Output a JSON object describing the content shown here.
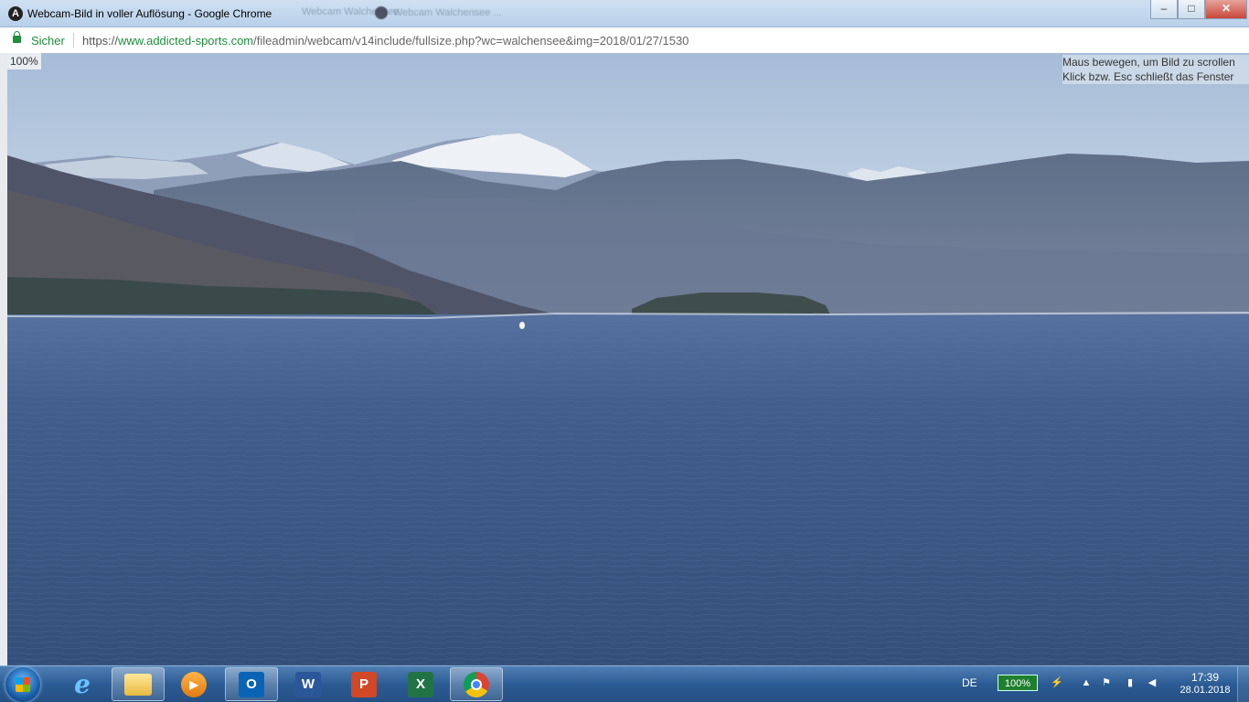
{
  "window": {
    "icon_letter": "A",
    "title": "Webcam-Bild in voller Auflösung - Google Chrome",
    "background_tabs": [
      "Webcam Walchensee",
      "Webcam Walchensee ..."
    ],
    "buttons": {
      "minimize": "–",
      "maximize": "□",
      "close": "✕"
    }
  },
  "address_bar": {
    "security_label": "Sicher",
    "url_scheme": "https://",
    "url_host": "www.addicted-sports.com",
    "url_path": "/fileadmin/webcam/v14include/fullsize.php?wc=walchensee&img=2018/01/27/1530"
  },
  "viewer": {
    "zoom_label": "100%",
    "hint_line1": "Maus bewegen, um Bild zu scrollen",
    "hint_line2": "Klick bzw. Esc schließt das Fenster"
  },
  "taskbar": {
    "apps": [
      {
        "name": "internet-explorer",
        "glyph": "e"
      },
      {
        "name": "file-explorer",
        "glyph": ""
      },
      {
        "name": "media-player",
        "glyph": "▶"
      },
      {
        "name": "outlook",
        "glyph": "O"
      },
      {
        "name": "word",
        "glyph": "W"
      },
      {
        "name": "powerpoint",
        "glyph": "P"
      },
      {
        "name": "excel",
        "glyph": "X"
      },
      {
        "name": "chrome",
        "glyph": ""
      }
    ],
    "language": "DE",
    "battery_label": "100%",
    "time": "17:39",
    "date": "28.01.2018"
  },
  "colors": {
    "lake": "#3d5a84",
    "sky_top": "#a8bed8",
    "secure_green": "#1e8e3e"
  }
}
